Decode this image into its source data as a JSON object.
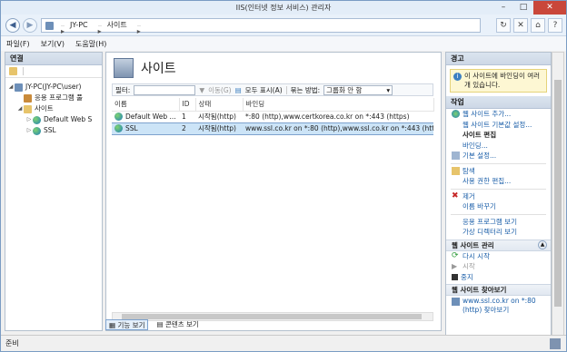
{
  "window": {
    "title": "IIS(인터넷 정보 서비스) 관리자"
  },
  "address": {
    "crumbs": [
      "JY-PC",
      "사이트"
    ]
  },
  "menu": {
    "items": [
      "파일(F)",
      "보기(V)",
      "도움말(H)"
    ]
  },
  "connections": {
    "header": "연결",
    "tree": [
      {
        "label": "JY-PC(JY-PC\\user)",
        "indent": 0,
        "icon": "computer-icon",
        "expand": "◢"
      },
      {
        "label": "응용 프로그램 풀",
        "indent": 1,
        "icon": "app-pool-icon",
        "expand": ""
      },
      {
        "label": "사이트",
        "indent": 1,
        "icon": "sites-folder-icon",
        "expand": "◢"
      },
      {
        "label": "Default Web S",
        "indent": 2,
        "icon": "website-globe-icon",
        "expand": "▷"
      },
      {
        "label": "SSL",
        "indent": 2,
        "icon": "website-globe-icon",
        "expand": "▷"
      }
    ]
  },
  "main": {
    "title": "사이트",
    "filter": {
      "label": "필터:",
      "go": "이동(G)",
      "show_all": "모두 표시(A)",
      "group_label": "묶는 방법:",
      "group_value": "그룹화 안 함"
    },
    "columns": [
      "이름",
      "ID",
      "상태",
      "바인딩"
    ],
    "rows": [
      {
        "name": "Default Web ...",
        "id": "1",
        "state": "시작됨(http)",
        "binding": "*:80 (http),www.certkorea.co.kr on *:443 (https)",
        "selected": false
      },
      {
        "name": "SSL",
        "id": "2",
        "state": "시작됨(http)",
        "binding": "www.ssl.co.kr on *:80 (http),www.ssl.co.kr on *:443 (https)",
        "selected": true
      }
    ],
    "view_tabs": [
      "기능 보기",
      "콘텐츠 보기"
    ]
  },
  "actions": {
    "alert_header": "경고",
    "alert_text": "이 사이트에 바인딩이 여러 개 있습니다.",
    "actions_header": "작업",
    "add_site": "웹 사이트 추가...",
    "site_defaults": "웹 사이트 기본값 설정...",
    "edit_site_header": "사이트 편집",
    "bindings": "바인딩...",
    "basic_settings": "기본 설정...",
    "explore": "탐색",
    "edit_permissions": "사용 권한 편집...",
    "remove": "제거",
    "rename": "이름 바꾸기",
    "view_apps": "응용 프로그램 보기",
    "view_vdirs": "가상 디렉터리 보기",
    "manage_header": "웹 사이트 관리",
    "restart": "다시 시작",
    "start": "시작",
    "stop": "중지",
    "browse_header": "웹 사이트 찾아보기",
    "browse_link": "www.ssl.co.kr on *:80 (http) 찾아보기"
  },
  "status": {
    "text": "준비"
  }
}
